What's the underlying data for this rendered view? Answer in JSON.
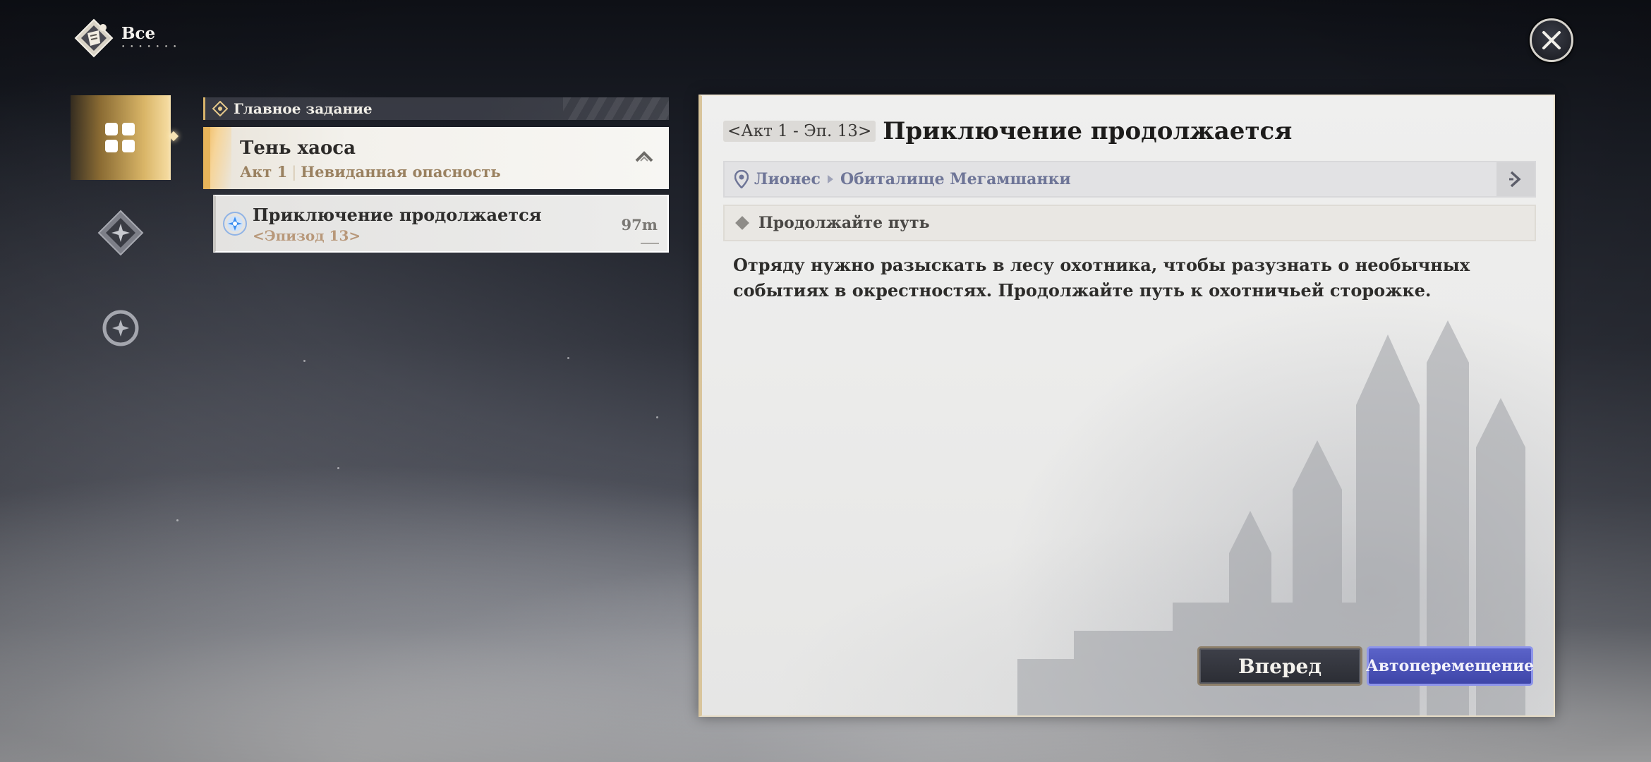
{
  "header": {
    "title": "Все",
    "subtitle": "• • • • • • •"
  },
  "sidebar": {
    "tabs": [
      {
        "name": "all-quests",
        "active": true
      },
      {
        "name": "main-quests",
        "active": false
      },
      {
        "name": "other-quests",
        "active": false
      }
    ]
  },
  "quest_list": {
    "section_label": "Главное задание",
    "group": {
      "title": "Тень хаоса",
      "act": "Акт 1",
      "chapter": "Невиданная опасность"
    },
    "items": [
      {
        "title": "Приключение продолжается",
        "episode": "<Эпизод 13>",
        "distance": "97m"
      }
    ]
  },
  "detail": {
    "episode_tag": "<Акт 1 - Эп. 13>",
    "title": "Приключение продолжается",
    "location": [
      "Лионес",
      "Обиталище Мегамшанки"
    ],
    "objective": "Продолжайте путь",
    "description": "Отряду нужно разыскать в лесу охотника, чтобы разузнать о необычных событиях в окрестностях. Продолжайте путь к охотничьей сторожке.",
    "buttons": {
      "forward": "Вперед",
      "auto": "Автоперемещение"
    }
  },
  "colors": {
    "accent_gold": "#e7b45a",
    "button_blue": "#4b53bb",
    "location_text": "#6e7597"
  }
}
